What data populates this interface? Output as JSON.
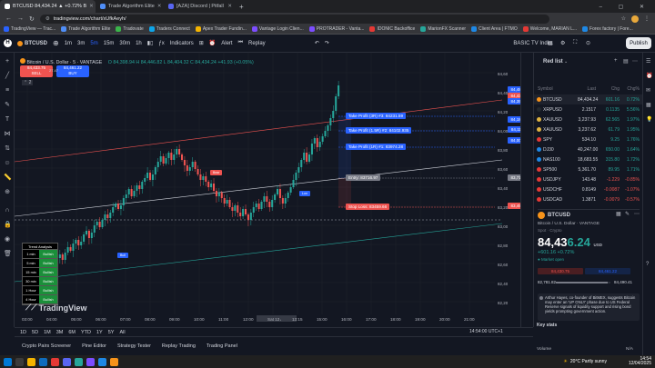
{
  "browser": {
    "tabs": [
      {
        "title": "BTCUSD 84,434.24 ▲ +0.72% B",
        "color": "#ffffff",
        "active": true
      },
      {
        "title": "Trade Algorithm Elite",
        "color": "#4f8ef7",
        "active": false
      },
      {
        "title": "[AZA] Discord | Pitfall",
        "color": "#5865f2",
        "active": false
      }
    ],
    "url": "tradingview.com/chart/xUfkAeyh/",
    "bookmarks": [
      "TradingView — Trac...",
      "Trade Algorithm Elite",
      "Tradovate",
      "Traders Connect",
      "Apex Trader Fundin...",
      "Vantage Login Clien...",
      "PROTRADER - Vanta...",
      "IDONIC Backoffice",
      "MarionFX Scanner",
      "Client Area | FTMO",
      "Welcome, MARIAN L...",
      "Forex factory | Fore..."
    ]
  },
  "toolbar": {
    "symbol": "BTCUSD",
    "timeframes": [
      "1m",
      "3m",
      "5m",
      "15m",
      "30m",
      "1h"
    ],
    "selected_tf": "5m",
    "indicators_label": "Indicators",
    "alert_label": "Alert",
    "replay_label": "Replay",
    "layout_label": "BASIC TV Indi...",
    "publish_label": "Publish"
  },
  "chart": {
    "title": "Bitcoin / U.S. Dollar · 5 · VANTAGE",
    "ohlc": "O 84,398.94 H 84,446.82 L 84,404.32 C 84,434.24 +41.93 (+0.05%)",
    "sell_price": "84,433.75",
    "sell_label": "SELL",
    "buy_price": "84,461.22",
    "buy_label": "BUY",
    "spread": "27.47",
    "watermark": "TradingView",
    "time_labels": [
      "03:00",
      "04:00",
      "05:00",
      "06:00",
      "07:00",
      "08:00",
      "09:00",
      "10:00",
      "11:00",
      "12:00",
      "Sat 12 Apr '25",
      "13:15",
      "15:00",
      "16:00",
      "17:00",
      "18:00",
      "19:00",
      "20:00",
      "21:00"
    ],
    "price_labels": [
      "84,600.00",
      "84,400.00",
      "84,200.00",
      "84,000.00",
      "83,800.00",
      "83,600.00",
      "83,400.00",
      "83,200.00",
      "83,000.00",
      "82,800.00",
      "82,600.00",
      "82,400.00",
      "82,200.00"
    ],
    "price_tags": [
      {
        "text": "84,481.21",
        "color": "#2962ff"
      },
      {
        "text": "84,433.75",
        "color": "#ef5350"
      },
      {
        "text": "84,350.72",
        "color": "#2962ff"
      },
      {
        "text": "84,188.39",
        "color": "#2962ff"
      },
      {
        "text": "84,111.40",
        "color": "#2962ff"
      },
      {
        "text": "84,003.68",
        "color": "#2962ff"
      },
      {
        "text": "83,716.84",
        "color": "#787b86"
      },
      {
        "text": "83,459.66",
        "color": "#ef5350"
      }
    ],
    "annotations": {
      "tp3": "Take Profit (3R) #3: 84231.59",
      "tp2": "Take Profit (1.5R) #2: 84102.935",
      "tp1": "Take Profit (1R) #1: 83974.28",
      "entry": "Entry: 83716.97",
      "sl": "Stop Loss: 83459.66",
      "bull1": "Bull",
      "bear1": "Bear",
      "long1": "Lon"
    },
    "trend_table": {
      "header": "Trend Analysis",
      "rows": [
        {
          "tf": "1 min",
          "state": "Bullish"
        },
        {
          "tf": "5 min",
          "state": "Bullish"
        },
        {
          "tf": "15 min",
          "state": "Bullish"
        },
        {
          "tf": "30 min",
          "state": "Bullish"
        },
        {
          "tf": "1 Hour",
          "state": "Bullish"
        },
        {
          "tf": "4 Hour",
          "state": "Bullish"
        }
      ]
    }
  },
  "watchlist": {
    "title": "Red list",
    "headers": [
      "Symbol",
      "Last",
      "Chg",
      "Chg%"
    ],
    "rows": [
      {
        "sym": "BTCUSD",
        "last": "84,434.24",
        "chg": "601.16",
        "chp": "0.72%",
        "dir": "pos",
        "color": "#f7931a"
      },
      {
        "sym": "XRPUSD",
        "last": "2.1517",
        "chg": "0.1135",
        "chp": "5.56%",
        "dir": "pos",
        "color": "#23292f"
      },
      {
        "sym": "XAUUSD",
        "last": "3,237.93",
        "chg": "62.565",
        "chp": "1.97%",
        "dir": "pos",
        "color": "#e0b341"
      },
      {
        "sym": "XAUUSD",
        "last": "3,237.62",
        "chg": "61.79",
        "chp": "1.95%",
        "dir": "pos",
        "color": "#e0b341"
      },
      {
        "sym": "SPY",
        "last": "534.10",
        "chg": "9.25",
        "chp": "1.76%",
        "dir": "pos",
        "color": "#e53935"
      },
      {
        "sym": "DJ30",
        "last": "40,247.00",
        "chg": "650.00",
        "chp": "1.64%",
        "dir": "pos",
        "color": "#1e88e5"
      },
      {
        "sym": "NAS100",
        "last": "18,683.55",
        "chg": "315.80",
        "chp": "1.72%",
        "dir": "pos",
        "color": "#1e88e5"
      },
      {
        "sym": "SP500",
        "last": "5,361.70",
        "chg": "89.95",
        "chp": "1.71%",
        "dir": "pos",
        "color": "#e53935"
      },
      {
        "sym": "USDJPY",
        "last": "143.48",
        "chg": "-1.229",
        "chp": "-0.85%",
        "dir": "neg",
        "color": "#e53935"
      },
      {
        "sym": "USDCHF",
        "last": "0.8149",
        "chg": "-0.0087",
        "chp": "-1.07%",
        "dir": "neg",
        "color": "#e53935"
      },
      {
        "sym": "USDCAD",
        "last": "1.3871",
        "chg": "-0.0079",
        "chp": "-0.57%",
        "dir": "neg",
        "color": "#e53935"
      }
    ],
    "detail": {
      "symbol": "BTCUSD",
      "name": "Bitcoin / U.S. Dollar · VANTAGE",
      "type": "Spot · Crypto",
      "price_main": "84,43",
      "price_tail": "6.24",
      "currency": "USD",
      "change": "+601.16 +0.72%",
      "status": "Market open",
      "bid": "84,430.75",
      "ask": "84,461.22",
      "low": "82,781.82",
      "high": "84,490.41",
      "news": "Arthur Hayes, co-founder of BitMEX, suggests Bitcoin may enter an 'UP ONLY' phase due to US Federal Reserve signals of liquidity support and rising bond yields prompting government action.",
      "key_stats": "Key stats",
      "volume_label": "Volume",
      "volume_value": "N/A"
    }
  },
  "bottom": {
    "ranges": [
      "1D",
      "5D",
      "1M",
      "3M",
      "6M",
      "YTD",
      "1Y",
      "5Y",
      "All"
    ],
    "clock": "14:54:00 UTC+1",
    "panels": [
      "Crypto Pairs Screener",
      "Pine Editor",
      "Strategy Tester",
      "Replay Trading",
      "Trading Panel"
    ]
  },
  "taskbar": {
    "weather": "20°C Partly sunny",
    "time": "14:54",
    "date": "12/04/2025"
  }
}
